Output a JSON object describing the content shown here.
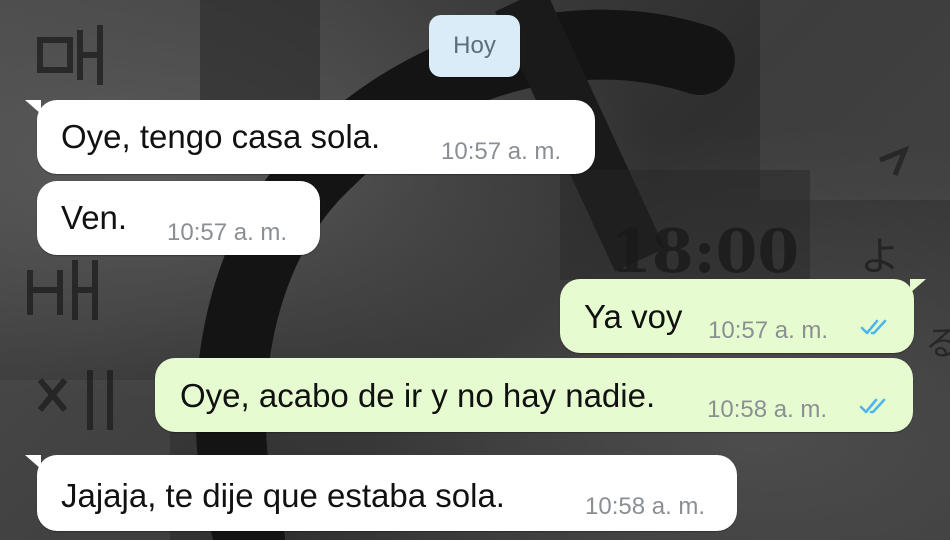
{
  "date_chip": {
    "label": "Hoy"
  },
  "messages": [
    {
      "direction": "incoming",
      "text": "Oye, tengo casa sola.",
      "time": "10:57 a. m."
    },
    {
      "direction": "incoming",
      "text": "Ven.",
      "time": "10:57 a. m."
    },
    {
      "direction": "outgoing",
      "text": "Ya voy",
      "time": "10:57 a. m.",
      "status_icon": "double-check-read-icon"
    },
    {
      "direction": "outgoing",
      "text": "Oye, acabo de ir y no hay nadie.",
      "time": "10:58 a. m.",
      "status_icon": "double-check-read-icon"
    },
    {
      "direction": "incoming",
      "text": "Jajaja, te dije que estaba sola.",
      "time": "10:58 a. m."
    }
  ],
  "colors": {
    "incoming_bubble": "#ffffff",
    "outgoing_bubble": "#e6fcd0",
    "date_chip": "#d9ecf7",
    "read_ticks": "#4fb6ec",
    "timestamp": "#8a8f93"
  }
}
